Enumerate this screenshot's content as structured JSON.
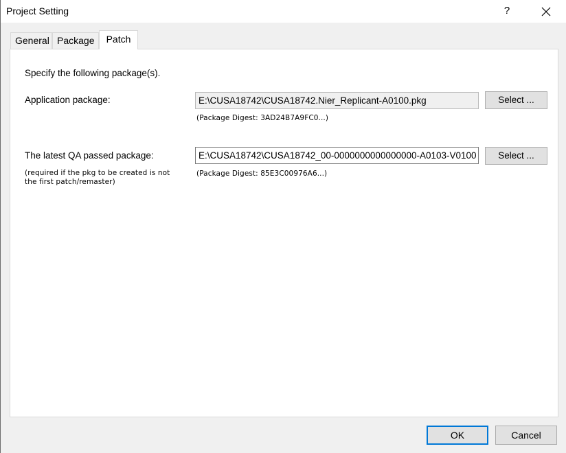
{
  "window": {
    "title": "Project Setting",
    "help_label": "?"
  },
  "tabs": [
    {
      "label": "General",
      "active": false
    },
    {
      "label": "Package",
      "active": false
    },
    {
      "label": "Patch",
      "active": true
    }
  ],
  "patch": {
    "instruction": "Specify the following package(s).",
    "app_package": {
      "label": "Application package:",
      "value": "E:\\CUSA18742\\CUSA18742.Nier_Replicant-A0100.pkg",
      "select_label": "Select ...",
      "digest": "(Package Digest: 3AD24B7A9FC0...)"
    },
    "qa_package": {
      "label": "The latest QA passed package:",
      "note_line1": "(required if the pkg to be created is not",
      "note_line2": "the first patch/remaster)",
      "value": "E:\\CUSA18742\\CUSA18742_00-0000000000000000-A0103-V0100",
      "select_label": "Select ...",
      "digest": "(Package Digest: 85E3C00976A6...)"
    }
  },
  "footer": {
    "ok_label": "OK",
    "cancel_label": "Cancel"
  },
  "colors": {
    "accent": "#0078d7",
    "dialog_bg": "#f0f0f0",
    "button_bg": "#e1e1e1"
  }
}
